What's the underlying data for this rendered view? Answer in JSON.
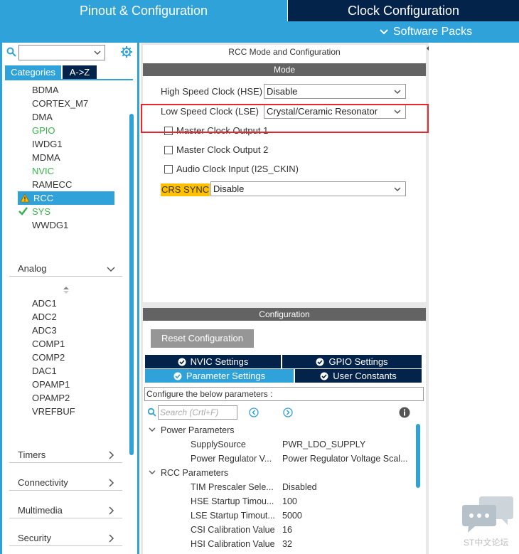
{
  "top_tabs": {
    "pinout": "Pinout & Configuration",
    "clock": "Clock Configuration"
  },
  "subbar": {
    "software_packs": "Software Packs"
  },
  "left": {
    "search_placeholder": "",
    "tab_categories": "Categories",
    "tab_az": "A->Z",
    "system_items": [
      {
        "label": "BDMA",
        "status": "normal"
      },
      {
        "label": "CORTEX_M7",
        "status": "normal"
      },
      {
        "label": "DMA",
        "status": "normal"
      },
      {
        "label": "GPIO",
        "status": "green"
      },
      {
        "label": "IWDG1",
        "status": "normal"
      },
      {
        "label": "MDMA",
        "status": "normal"
      },
      {
        "label": "NVIC",
        "status": "green"
      },
      {
        "label": "RAMECC",
        "status": "normal"
      },
      {
        "label": "RCC",
        "status": "warning-selected"
      },
      {
        "label": "SYS",
        "status": "checked-green"
      },
      {
        "label": "WWDG1",
        "status": "normal"
      }
    ],
    "analog_header": "Analog",
    "analog_items": [
      "ADC1",
      "ADC2",
      "ADC3",
      "COMP1",
      "COMP2",
      "DAC1",
      "OPAMP1",
      "OPAMP2",
      "VREFBUF"
    ],
    "sections": [
      "Timers",
      "Connectivity",
      "Multimedia",
      "Security"
    ]
  },
  "mode": {
    "title": "RCC Mode and Configuration",
    "bar": "Mode",
    "hse_label": "High Speed Clock (HSE)",
    "hse_value": "Disable",
    "lse_label": "Low Speed Clock (LSE)",
    "lse_value": "Crystal/Ceramic Resonator",
    "mco1": "Master Clock Output 1",
    "mco2": "Master Clock Output 2",
    "audio": "Audio Clock Input (I2S_CKIN)",
    "crs_label": "CRS SYNC",
    "crs_value": "Disable"
  },
  "config": {
    "bar": "Configuration",
    "reset": "Reset Configuration",
    "tabs": {
      "nvic": "NVIC Settings",
      "gpio": "GPIO Settings",
      "params": "Parameter Settings",
      "user": "User Constants"
    },
    "desc": "Configure the below parameters :",
    "search_placeholder": "Search (Crtl+F)",
    "groups": [
      {
        "name": "Power Parameters",
        "rows": [
          {
            "key": "SupplySource",
            "value": "PWR_LDO_SUPPLY"
          },
          {
            "key": "Power Regulator V...",
            "value": "Power Regulator Voltage Scal..."
          }
        ]
      },
      {
        "name": "RCC Parameters",
        "rows": [
          {
            "key": "TIM Prescaler Sele...",
            "value": "Disabled"
          },
          {
            "key": "HSE Startup Timou...",
            "value": "100"
          },
          {
            "key": "LSE Startup Timout...",
            "value": "5000"
          },
          {
            "key": "CSI Calibration Value",
            "value": "16"
          },
          {
            "key": "HSI Calibration Value",
            "value": "32"
          }
        ]
      }
    ]
  },
  "watermark": "ST中文论坛",
  "colors": {
    "accent": "#2fa2da",
    "dark": "#03234b",
    "highlight": "#ffc000",
    "red": "#e8262c",
    "green": "#35b44a"
  }
}
